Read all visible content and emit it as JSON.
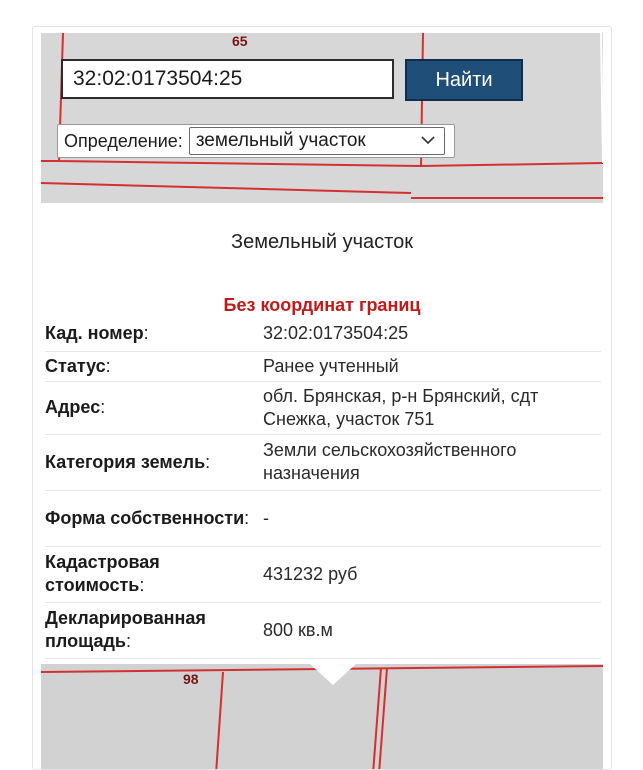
{
  "map": {
    "plot_number_top": "65",
    "plot_number_bottom": "98"
  },
  "search": {
    "query": "32:02:0173504:25",
    "button_label": "Найти"
  },
  "definition": {
    "label": "Определение:",
    "selected": "земельный участок",
    "chevron_icon": "chevron-down-icon"
  },
  "popup": {
    "title": "Земельный участок",
    "warning": "Без координат границ",
    "warning_color": "#c21a1a",
    "rows": [
      {
        "key": "Кад. номер",
        "value": "32:02:0173504:25"
      },
      {
        "key": "Статус",
        "value": "Ранее учтенный"
      },
      {
        "key": "Адрес",
        "value": "обл. Брянская, р-н Брянский, сдт Снежка, участок 751"
      },
      {
        "key": "Категория земель",
        "value": "Земли сельскохозяйственного назначения"
      },
      {
        "key": "Форма собственности",
        "value": "-"
      },
      {
        "key": "Кадастровая стоимость",
        "value": "431232 руб"
      },
      {
        "key": "Декларированная площадь",
        "value": "800 кв.м"
      }
    ]
  },
  "colors": {
    "button_bg": "#1f4e78",
    "map_bg": "#d7d7d7",
    "boundary_line": "#d33030"
  }
}
